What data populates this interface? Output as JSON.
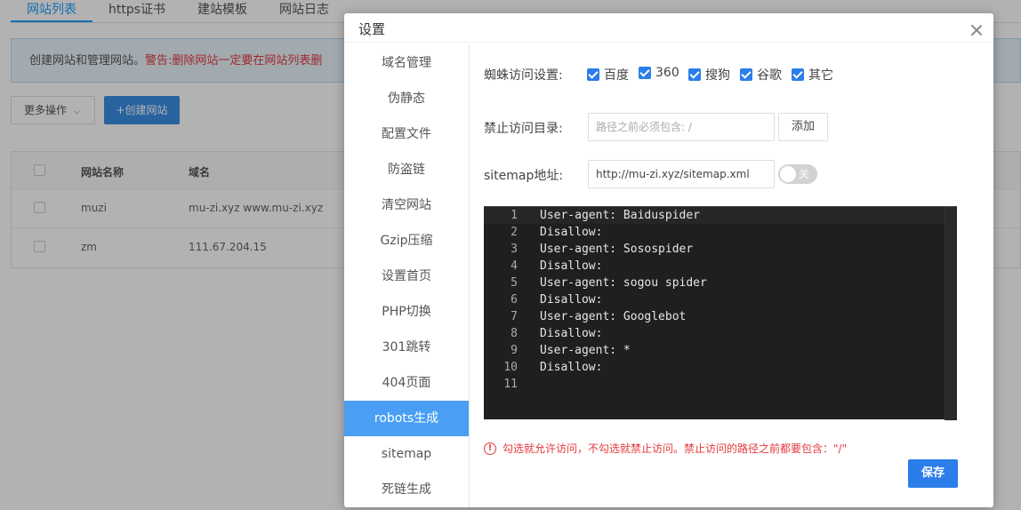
{
  "background": {
    "tabs": [
      "网站列表",
      "https证书",
      "建站模板",
      "网站日志"
    ],
    "notice": {
      "text": "创建网站和管理网站。",
      "warning": "警告:删除网站一定要在网站列表删"
    },
    "more_button": "更多操作",
    "create_button": "+创建网站",
    "table": {
      "headers": [
        "网站名称",
        "域名"
      ],
      "rows": [
        {
          "name": "muzi",
          "domain": "mu-zi.xyz www.mu-zi.xyz"
        },
        {
          "name": "zm",
          "domain": "111.67.204.15"
        }
      ]
    }
  },
  "dialog": {
    "title": "设置",
    "menu": [
      "域名管理",
      "伪静态",
      "配置文件",
      "防盗链",
      "清空网站",
      "Gzip压缩",
      "设置首页",
      "PHP切换",
      "301跳转",
      "404页面",
      "robots生成",
      "sitemap",
      "死链生成"
    ],
    "active_menu_index": 10,
    "spider": {
      "label": "蜘蛛访问设置:",
      "options": [
        {
          "label": "百度",
          "checked": true
        },
        {
          "label": "360",
          "checked": true
        },
        {
          "label": "搜狗",
          "checked": true
        },
        {
          "label": "谷歌",
          "checked": true
        },
        {
          "label": "其它",
          "checked": true
        }
      ]
    },
    "disallow": {
      "label": "禁止访问目录:",
      "placeholder": "路径之前必须包含: /",
      "add_button": "添加"
    },
    "sitemap": {
      "label": "sitemap地址:",
      "value": "http://mu-zi.xyz/sitemap.xml",
      "toggle_label": "关",
      "toggle_on": false
    },
    "editor_lines": [
      {
        "n": "1",
        "text": "User-agent: Baiduspider"
      },
      {
        "n": "2",
        "text": "Disallow:"
      },
      {
        "n": "3",
        "text": "User-agent: Sosospider"
      },
      {
        "n": "4",
        "text": "Disallow:"
      },
      {
        "n": "5",
        "text": "User-agent: sogou spider"
      },
      {
        "n": "6",
        "text": "Disallow:"
      },
      {
        "n": "7",
        "text": "User-agent: Googlebot"
      },
      {
        "n": "8",
        "text": "Disallow:"
      },
      {
        "n": "9",
        "text": "User-agent: *"
      },
      {
        "n": "10",
        "text": "Disallow:"
      },
      {
        "n": "11",
        "text": ""
      }
    ],
    "tip": "勾选就允许访问，不勾选就禁止访问。禁止访问的路径之前都要包含：\"/\"",
    "save_button": "保存"
  }
}
